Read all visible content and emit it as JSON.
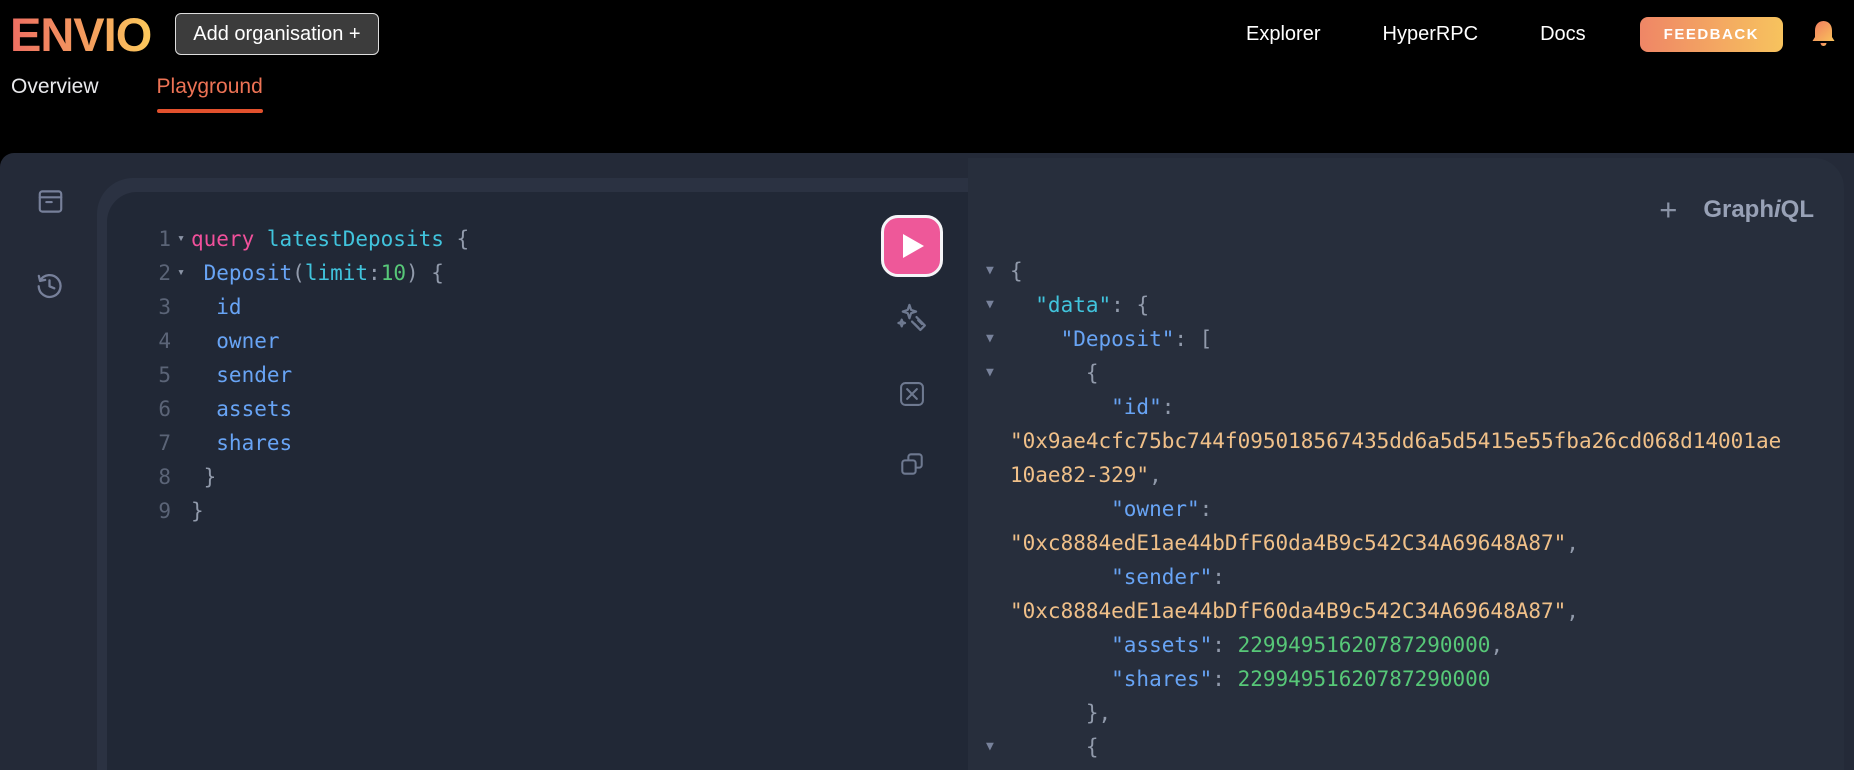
{
  "header": {
    "logo": "ENVIO",
    "add_organisation_label": "Add organisation +",
    "nav_links": [
      "Explorer",
      "HyperRPC",
      "Docs"
    ],
    "feedback_label": "FEEDBACK"
  },
  "tabs": {
    "overview": "Overview",
    "playground": "Playground",
    "active_tab": "Playground"
  },
  "graphiql": {
    "add_tab_label": "+",
    "logo": {
      "graph": "Graph",
      "i": "i",
      "ql": "QL"
    }
  },
  "colors": {
    "brand_gradient_start": "#ee6e62",
    "brand_gradient_end": "#fcc95c",
    "tab_active": "#ed7355",
    "tab_underline": "#e2512d",
    "execute_button": "#ee5899",
    "keyword_pink": "#f1509b",
    "cyan": "#41c4dd",
    "field_blue": "#68a4f5",
    "number_green": "#57c878",
    "string_peach": "#f0c089",
    "editor_bg": "#212836",
    "response_bg": "#272e3c"
  },
  "editor": {
    "lines": [
      {
        "num": "1",
        "fold": true,
        "tokens": [
          {
            "c": "kw",
            "s": "query"
          },
          {
            "c": "cy",
            "s": " latestDeposits"
          },
          {
            "c": "p",
            "s": " {"
          }
        ]
      },
      {
        "num": "2",
        "fold": true,
        "tokens": [
          {
            "c": "fb",
            "s": " Deposit"
          },
          {
            "c": "p",
            "s": "("
          },
          {
            "c": "cy",
            "s": "limit"
          },
          {
            "c": "p",
            "s": ":"
          },
          {
            "c": "num",
            "s": "10"
          },
          {
            "c": "p",
            "s": ") {"
          }
        ]
      },
      {
        "num": "3",
        "tokens": [
          {
            "c": "fb",
            "s": "  id"
          }
        ]
      },
      {
        "num": "4",
        "tokens": [
          {
            "c": "fb",
            "s": "  owner"
          }
        ]
      },
      {
        "num": "5",
        "tokens": [
          {
            "c": "fb",
            "s": "  sender"
          }
        ]
      },
      {
        "num": "6",
        "tokens": [
          {
            "c": "fb",
            "s": "  assets"
          }
        ]
      },
      {
        "num": "7",
        "tokens": [
          {
            "c": "fb",
            "s": "  shares"
          }
        ]
      },
      {
        "num": "8",
        "tokens": [
          {
            "c": "p",
            "s": " }"
          }
        ]
      },
      {
        "num": "9",
        "tokens": [
          {
            "c": "p",
            "s": "}"
          }
        ]
      }
    ]
  },
  "response": {
    "lines": [
      {
        "fold": true,
        "tokens": [
          {
            "c": "p",
            "s": "{"
          }
        ]
      },
      {
        "fold": true,
        "tokens": [
          {
            "c": "kc",
            "s": "  \"data\""
          },
          {
            "c": "p",
            "s": ": {"
          }
        ]
      },
      {
        "fold": true,
        "tokens": [
          {
            "c": "kb",
            "s": "    \"Deposit\""
          },
          {
            "c": "p",
            "s": ": ["
          }
        ]
      },
      {
        "fold": true,
        "tokens": [
          {
            "c": "p",
            "s": "      {"
          }
        ]
      },
      {
        "tokens": [
          {
            "c": "kb",
            "s": "        \"id\""
          },
          {
            "c": "p",
            "s": ":"
          }
        ]
      },
      {
        "tokens": [
          {
            "c": "str",
            "s": "\"0x9ae4cfc75bc744f095018567435dd6a5d5415e55fba26cd068d14001ae"
          }
        ]
      },
      {
        "tokens": [
          {
            "c": "str",
            "s": "10ae82-329\""
          },
          {
            "c": "p",
            "s": ","
          }
        ]
      },
      {
        "tokens": [
          {
            "c": "kb",
            "s": "        \"owner\""
          },
          {
            "c": "p",
            "s": ":"
          }
        ]
      },
      {
        "tokens": [
          {
            "c": "str",
            "s": "\"0xc8884edE1ae44bDfF60da4B9c542C34A69648A87\""
          },
          {
            "c": "p",
            "s": ","
          }
        ]
      },
      {
        "tokens": [
          {
            "c": "kb",
            "s": "        \"sender\""
          },
          {
            "c": "p",
            "s": ":"
          }
        ]
      },
      {
        "tokens": [
          {
            "c": "str",
            "s": "\"0xc8884edE1ae44bDfF60da4B9c542C34A69648A87\""
          },
          {
            "c": "p",
            "s": ","
          }
        ]
      },
      {
        "tokens": [
          {
            "c": "kb",
            "s": "        \"assets\""
          },
          {
            "c": "p",
            "s": ": "
          },
          {
            "c": "num",
            "s": "22994951620787290000"
          },
          {
            "c": "p",
            "s": ","
          }
        ]
      },
      {
        "tokens": [
          {
            "c": "kb",
            "s": "        \"shares\""
          },
          {
            "c": "p",
            "s": ": "
          },
          {
            "c": "num",
            "s": "22994951620787290000"
          }
        ]
      },
      {
        "tokens": [
          {
            "c": "p",
            "s": "      },"
          }
        ]
      },
      {
        "fold": true,
        "tokens": [
          {
            "c": "p",
            "s": "      {"
          }
        ]
      }
    ]
  }
}
